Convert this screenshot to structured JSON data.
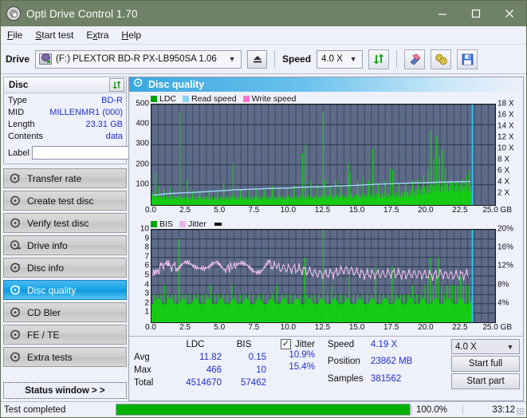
{
  "window": {
    "title": "Opti Drive Control 1.70",
    "minimize": "minimize-icon",
    "maximize": "maximize-icon",
    "close": "close-icon"
  },
  "menu": {
    "items": [
      "File",
      "Start test",
      "Extra",
      "Help"
    ]
  },
  "toolbar": {
    "drive_label": "Drive",
    "drive_value": "(F:)  PLEXTOR BD-R  PX-LB950SA 1.06",
    "eject": "eject-icon",
    "speed_label": "Speed",
    "speed_value": "4.0 X",
    "refresh": "refresh-icon",
    "erase": "eraser-icon",
    "disc_tools": "disc-tools-icon",
    "save": "save-icon"
  },
  "disc": {
    "header": "Disc",
    "refresh": "refresh-icon",
    "rows": [
      {
        "key": "Type",
        "value": "BD-R"
      },
      {
        "key": "MID",
        "value": "MILLENMR1 (000)"
      },
      {
        "key": "Length",
        "value": "23.31 GB"
      },
      {
        "key": "Contents",
        "value": "data"
      }
    ],
    "label_key": "Label",
    "label_value": "",
    "label_placeholder": "",
    "label_button": "disc-label-icon"
  },
  "nav": {
    "items": [
      {
        "label": "Transfer rate",
        "active": false
      },
      {
        "label": "Create test disc",
        "active": false
      },
      {
        "label": "Verify test disc",
        "active": false
      },
      {
        "label": "Drive info",
        "active": false
      },
      {
        "label": "Disc info",
        "active": false
      },
      {
        "label": "Disc quality",
        "active": true
      },
      {
        "label": "CD Bler",
        "active": false
      },
      {
        "label": "FE / TE",
        "active": false
      },
      {
        "label": "Extra tests",
        "active": false
      }
    ],
    "status_window": "Status window > >"
  },
  "panel": {
    "title": "Disc quality",
    "icon": "disc-quality-icon"
  },
  "chart_data": [
    {
      "type": "area",
      "title": "LDC / Read speed",
      "xlabel": "GB",
      "ylabel": "LDC",
      "xlim": [
        0,
        25
      ],
      "ylim": [
        0,
        500
      ],
      "y2lim": [
        0,
        18
      ],
      "y2label": "X",
      "grid": true,
      "legend_position": "top-left",
      "legend": [
        {
          "name": "LDC",
          "color": "#00a000"
        },
        {
          "name": "Read speed",
          "color": "#8ed2f0"
        },
        {
          "name": "Write speed",
          "color": "#ff73d0"
        }
      ],
      "xticks": [
        "0.0",
        "2.5",
        "5.0",
        "7.5",
        "10.0",
        "12.5",
        "15.0",
        "17.5",
        "20.0",
        "22.5",
        "25.0"
      ],
      "yticks": [
        100,
        200,
        300,
        400,
        500
      ],
      "y2ticks": [
        "2 X",
        "4 X",
        "6 X",
        "8 X",
        "10 X",
        "12 X",
        "14 X",
        "16 X",
        "18 X"
      ],
      "xunit": "GB",
      "series": [
        {
          "name": "LDC",
          "color": "#00c000",
          "baseline_x": [
            0,
            1,
            2,
            3,
            4,
            5,
            6,
            7,
            8,
            9,
            10,
            11,
            12,
            13,
            14,
            15,
            16,
            17,
            18,
            19,
            20,
            21,
            22,
            23.3
          ],
          "baseline_y": [
            38,
            30,
            28,
            26,
            26,
            26,
            28,
            26,
            26,
            26,
            28,
            30,
            30,
            30,
            32,
            34,
            34,
            36,
            38,
            44,
            58,
            66,
            70,
            66
          ],
          "spikes": [
            [
              0.3,
              160
            ],
            [
              0.55,
              95
            ],
            [
              0.9,
              80
            ],
            [
              1.35,
              90
            ],
            [
              2.05,
              462
            ],
            [
              2.6,
              128
            ],
            [
              3.0,
              70
            ],
            [
              3.5,
              72
            ],
            [
              4.2,
              66
            ],
            [
              4.8,
              70
            ],
            [
              5.25,
              110
            ],
            [
              5.95,
              208
            ],
            [
              6.5,
              75
            ],
            [
              7.1,
              70
            ],
            [
              7.6,
              85
            ],
            [
              8.2,
              72
            ],
            [
              8.8,
              95
            ],
            [
              9.3,
              80
            ],
            [
              9.9,
              88
            ],
            [
              10.4,
              96
            ],
            [
              11.0,
              258
            ],
            [
              11.2,
              300
            ],
            [
              11.6,
              118
            ],
            [
              12.05,
              100
            ],
            [
              12.5,
              466
            ],
            [
              12.6,
              120
            ],
            [
              13.0,
              92
            ],
            [
              13.4,
              120
            ],
            [
              13.8,
              95
            ],
            [
              14.3,
              205
            ],
            [
              14.45,
              160
            ],
            [
              15.0,
              120
            ],
            [
              15.4,
              140
            ],
            [
              15.8,
              120
            ],
            [
              16.1,
              278
            ],
            [
              16.5,
              110
            ],
            [
              17.0,
              120
            ],
            [
              17.4,
              182
            ],
            [
              17.55,
              175
            ],
            [
              18.0,
              108
            ],
            [
              18.5,
              105
            ],
            [
              19.0,
              120
            ],
            [
              19.4,
              130
            ],
            [
              19.8,
              145
            ],
            [
              20.1,
              175
            ],
            [
              20.35,
              372
            ],
            [
              20.55,
              230
            ],
            [
              20.75,
              338
            ],
            [
              20.95,
              240
            ],
            [
              21.15,
              272
            ],
            [
              21.4,
              180
            ],
            [
              21.8,
              120
            ],
            [
              22.2,
              115
            ],
            [
              22.6,
              130
            ],
            [
              22.9,
              150
            ],
            [
              23.1,
              175
            ]
          ]
        },
        {
          "name": "Read speed",
          "color": "#9fd9f5",
          "x": [
            0.1,
            1.0,
            2.0,
            3.0,
            4.0,
            5.0,
            6.0,
            7.0,
            8.5,
            10.0,
            11.0,
            12.5,
            14.0,
            15.0,
            16.3,
            17.5,
            19.0,
            20.0,
            21.0,
            22.0,
            23.2
          ],
          "y_x": [
            1.75,
            2.0,
            2.15,
            2.25,
            2.4,
            2.55,
            2.7,
            2.8,
            2.95,
            3.05,
            3.2,
            3.3,
            3.45,
            3.55,
            3.7,
            3.8,
            3.95,
            4.0,
            4.1,
            4.15,
            4.2
          ]
        }
      ],
      "end_marker_x": 23.35,
      "end_marker_color": "#35c4f4"
    },
    {
      "type": "area",
      "title": "BIS / Jitter",
      "xlabel": "GB",
      "ylabel": "BIS",
      "xlim": [
        0,
        25
      ],
      "ylim": [
        0,
        10
      ],
      "y2lim": [
        0,
        20
      ],
      "y2label": "%",
      "grid": true,
      "legend_position": "top-left",
      "legend": [
        {
          "name": "BIS",
          "color": "#00a000"
        },
        {
          "name": "Jitter",
          "color": "#e8b8e8"
        }
      ],
      "xticks": [
        "0.0",
        "2.5",
        "5.0",
        "7.5",
        "10.0",
        "12.5",
        "15.0",
        "17.5",
        "20.0",
        "22.5",
        "25.0"
      ],
      "yticks": [
        1,
        2,
        3,
        4,
        5,
        6,
        7,
        8,
        9,
        10
      ],
      "y2ticks": [
        "4%",
        "8%",
        "12%",
        "16%",
        "20%"
      ],
      "xunit": "GB",
      "series": [
        {
          "name": "BIS",
          "color": "#00c000",
          "baseline_level": 2.0,
          "spikes": [
            [
              0.2,
              3
            ],
            [
              0.45,
              3
            ],
            [
              0.7,
              3
            ],
            [
              0.95,
              4
            ],
            [
              1.2,
              3
            ],
            [
              1.5,
              3
            ],
            [
              1.75,
              3
            ],
            [
              2.0,
              9
            ],
            [
              2.25,
              3
            ],
            [
              2.5,
              3
            ],
            [
              2.8,
              3
            ],
            [
              3.1,
              3
            ],
            [
              3.4,
              3
            ],
            [
              3.7,
              3
            ],
            [
              4.0,
              3
            ],
            [
              4.3,
              4
            ],
            [
              4.6,
              3
            ],
            [
              4.9,
              3
            ],
            [
              5.2,
              3
            ],
            [
              5.5,
              3
            ],
            [
              5.85,
              4
            ],
            [
              6.1,
              3
            ],
            [
              6.45,
              3
            ],
            [
              6.8,
              3
            ],
            [
              7.1,
              3
            ],
            [
              7.45,
              3
            ],
            [
              7.8,
              3
            ],
            [
              8.1,
              3
            ],
            [
              8.45,
              3
            ],
            [
              8.8,
              3
            ],
            [
              9.1,
              4
            ],
            [
              9.5,
              3
            ],
            [
              9.8,
              3
            ],
            [
              10.1,
              3
            ],
            [
              10.45,
              3
            ],
            [
              10.8,
              3
            ],
            [
              11.15,
              7
            ],
            [
              11.3,
              3
            ],
            [
              11.6,
              3
            ],
            [
              11.9,
              3
            ],
            [
              12.2,
              3
            ],
            [
              12.5,
              10
            ],
            [
              12.8,
              3
            ],
            [
              13.1,
              4
            ],
            [
              13.4,
              3
            ],
            [
              13.75,
              3
            ],
            [
              14.1,
              3
            ],
            [
              14.4,
              5
            ],
            [
              14.7,
              3
            ],
            [
              15.0,
              3
            ],
            [
              15.4,
              3
            ],
            [
              15.7,
              3
            ],
            [
              16.0,
              3
            ],
            [
              16.3,
              6
            ],
            [
              16.6,
              3
            ],
            [
              16.9,
              3
            ],
            [
              17.2,
              3
            ],
            [
              17.5,
              6
            ],
            [
              17.8,
              3
            ],
            [
              18.1,
              3
            ],
            [
              18.4,
              3
            ],
            [
              18.7,
              3
            ],
            [
              19.0,
              4
            ],
            [
              19.3,
              3
            ],
            [
              19.6,
              3
            ],
            [
              19.9,
              4
            ],
            [
              20.1,
              5
            ],
            [
              20.3,
              7
            ],
            [
              20.5,
              4
            ],
            [
              20.7,
              5
            ],
            [
              20.9,
              7
            ],
            [
              21.1,
              4
            ],
            [
              21.3,
              3
            ],
            [
              21.5,
              4
            ],
            [
              21.7,
              4
            ],
            [
              21.9,
              4
            ],
            [
              22.1,
              4
            ],
            [
              22.3,
              4
            ],
            [
              22.5,
              5
            ],
            [
              22.7,
              4
            ],
            [
              22.9,
              4
            ],
            [
              23.1,
              4
            ]
          ]
        },
        {
          "name": "Jitter",
          "color": "#eec0ea",
          "x": [
            0.1,
            0.5,
            1.0,
            1.3,
            1.8,
            2.4,
            3.0,
            3.6,
            4.2,
            4.8,
            5.4,
            6.2,
            6.8,
            7.4,
            8.0,
            8.6,
            9.1,
            9.8,
            10.5,
            11.2,
            11.9,
            12.6,
            13.3,
            14.0,
            14.7,
            15.4,
            16.1,
            16.8,
            17.5,
            18.2,
            18.9,
            19.6,
            20.3,
            21.0,
            21.7,
            22.4,
            23.1
          ],
          "y_pct": [
            10.6,
            11.2,
            13.0,
            12.4,
            11.8,
            12.2,
            12.0,
            12.6,
            11.8,
            12.2,
            11.6,
            12.4,
            11.8,
            11.6,
            11.6,
            12.6,
            11.8,
            11.6,
            11.6,
            11.2,
            10.6,
            10.4,
            10.6,
            11.4,
            11.0,
            10.4,
            10.4,
            10.4,
            10.6,
            10.4,
            10.4,
            10.4,
            10.2,
            10.4,
            10.2,
            10.2,
            10.4
          ]
        }
      ],
      "end_marker_x": 23.35,
      "end_marker_color": "#35c4f4"
    }
  ],
  "stats": {
    "col_headers": [
      "LDC",
      "BIS"
    ],
    "rows": [
      {
        "key": "Avg",
        "ldc": "11.82",
        "bis": "0.15"
      },
      {
        "key": "Max",
        "ldc": "466",
        "bis": "10"
      },
      {
        "key": "Total",
        "ldc": "4514670",
        "bis": "57462"
      }
    ],
    "jitter": {
      "label": "Jitter",
      "checked": true,
      "avg": "10.9%",
      "max": "15.4%"
    },
    "speed_label": "Speed",
    "speed_value": "4.19 X",
    "position_label": "Position",
    "position_value": "23862 MB",
    "samples_label": "Samples",
    "samples_value": "381562",
    "speed_select": "4.0 X",
    "start_full": "Start full",
    "start_part": "Start part"
  },
  "statusbar": {
    "message": "Test completed",
    "progress_percent": "100.0%",
    "progress_value": 100,
    "elapsed": "33:12"
  }
}
